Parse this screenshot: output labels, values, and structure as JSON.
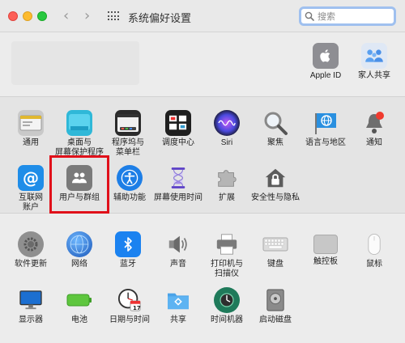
{
  "window": {
    "title": "系统偏好设置"
  },
  "nav": {
    "back": "‹",
    "forward": "›"
  },
  "search": {
    "placeholder": "搜索"
  },
  "account_items": [
    {
      "label": "Apple ID",
      "icon": "apple-logo-icon"
    },
    {
      "label": "家人共享",
      "icon": "family-sharing-icon"
    }
  ],
  "row1": [
    {
      "label": "通用",
      "icon": "general-icon"
    },
    {
      "label": "桌面与\n屏幕保护程序",
      "icon": "desktop-icon"
    },
    {
      "label": "程序坞与\n菜单栏",
      "icon": "dock-icon"
    },
    {
      "label": "调度中心",
      "icon": "mission-control-icon"
    },
    {
      "label": "Siri",
      "icon": "siri-icon"
    },
    {
      "label": "聚焦",
      "icon": "spotlight-icon"
    },
    {
      "label": "语言与地区",
      "icon": "language-flag-icon"
    },
    {
      "label": "通知",
      "icon": "notification-bell-icon"
    }
  ],
  "row2": [
    {
      "label": "互联网\n账户",
      "icon": "at-sign-icon"
    },
    {
      "label": "用户与群组",
      "icon": "users-groups-icon"
    },
    {
      "label": "辅助功能",
      "icon": "accessibility-icon"
    },
    {
      "label": "屏幕使用时间",
      "icon": "hourglass-icon"
    },
    {
      "label": "扩展",
      "icon": "puzzle-icon"
    },
    {
      "label": "安全性与隐私",
      "icon": "house-lock-icon"
    }
  ],
  "row3": [
    {
      "label": "软件更新",
      "icon": "gear-update-icon"
    },
    {
      "label": "网络",
      "icon": "globe-network-icon"
    },
    {
      "label": "蓝牙",
      "icon": "bluetooth-icon"
    },
    {
      "label": "声音",
      "icon": "speaker-icon"
    },
    {
      "label": "打印机与\n扫描仪",
      "icon": "printer-icon"
    },
    {
      "label": "键盘",
      "icon": "keyboard-icon"
    },
    {
      "label": "触控板",
      "icon": "trackpad-icon"
    },
    {
      "label": "鼠标",
      "icon": "mouse-icon"
    }
  ],
  "row4": [
    {
      "label": "显示器",
      "icon": "display-icon"
    },
    {
      "label": "电池",
      "icon": "battery-icon"
    },
    {
      "label": "日期与时间",
      "icon": "clock-calendar-icon"
    },
    {
      "label": "共享",
      "icon": "folder-share-icon"
    },
    {
      "label": "时间机器",
      "icon": "time-machine-icon"
    },
    {
      "label": "启动磁盘",
      "icon": "disk-icon"
    }
  ],
  "calendar_day": "17",
  "colors": {
    "highlight": "#e0101a",
    "search_focus": "#9fc0ef"
  }
}
